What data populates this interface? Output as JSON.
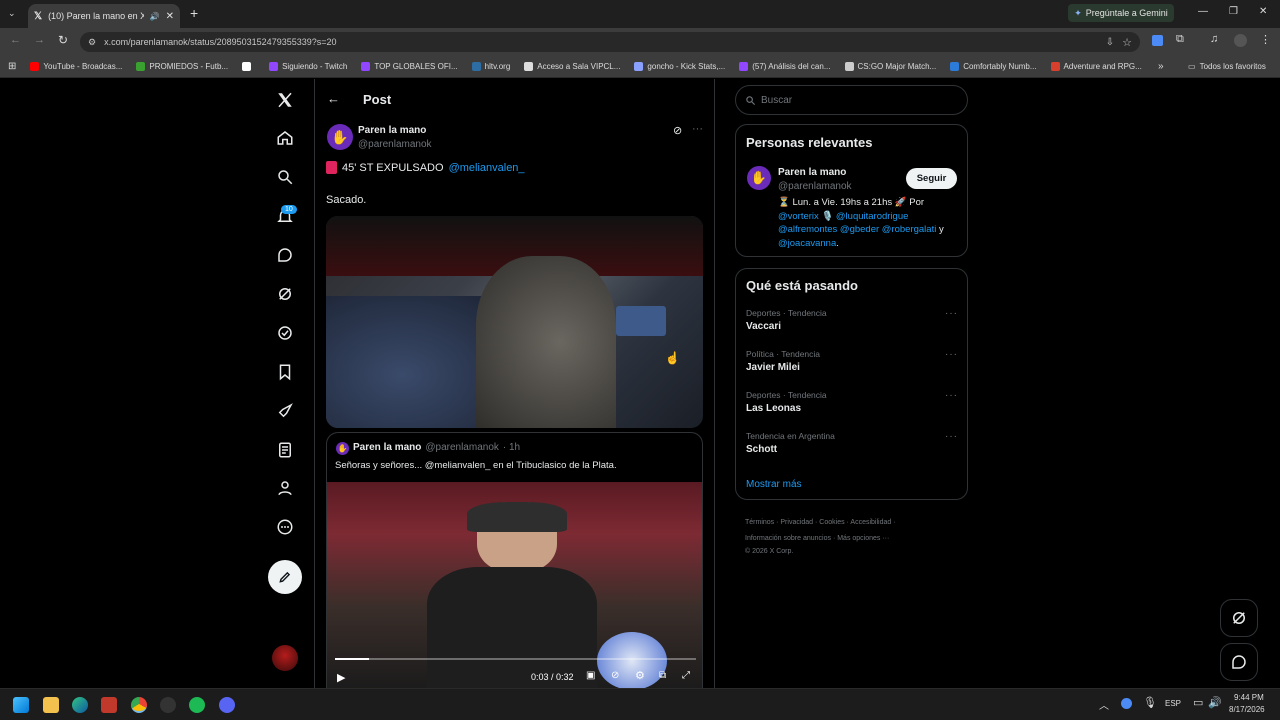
{
  "browser": {
    "tab_title": "(10) Paren la mano en X: \"",
    "url": "x.com/parenlamanok/status/2089503152479355339?s=20",
    "gemini_label": "Pregúntale a Gemini",
    "bookmarks": [
      {
        "label": "YouTube - Broadcas...",
        "color": "#ff0000"
      },
      {
        "label": "PROMIEDOS - Futb...",
        "color": "#3aa02f"
      },
      {
        "label": "",
        "color": "#ffffff"
      },
      {
        "label": "Siguiendo - Twitch",
        "color": "#9146ff"
      },
      {
        "label": "TOP GLOBALES OFI...",
        "color": "#9146ff"
      },
      {
        "label": "hltv.org",
        "color": "#2d6da3"
      },
      {
        "label": "Acceso a Sala VIPCL...",
        "color": "#dddddd"
      },
      {
        "label": "goncho - Kick Stats,...",
        "color": "#8aa0ff"
      },
      {
        "label": "(57) Análisis del can...",
        "color": "#9146ff"
      },
      {
        "label": "CS:GO Major Match...",
        "color": "#cccccc"
      },
      {
        "label": "Comfortably Numb...",
        "color": "#2d7bd8"
      },
      {
        "label": "Adventure and RPG...",
        "color": "#d8402d"
      }
    ],
    "all_bookmarks": "Todos los favoritos"
  },
  "sidebar": {
    "notification_count": "10"
  },
  "post": {
    "header_title": "Post",
    "author_name": "Paren la mano",
    "author_handle": "@parenlamanok",
    "text_prefix": "45' ST EXPULSADO",
    "text_mention": "@melianvalen_",
    "text_line2": "Sacado.",
    "quote_author": "Paren la mano",
    "quote_handle": "@parenlamanok",
    "quote_time": "· 1h",
    "quote_text": "Señoras y señores... @melianvalen_ en el Tribuclasico de la Plata.",
    "video_time": "0:03 / 0:32",
    "video_progress": 0.094
  },
  "right": {
    "search_placeholder": "Buscar",
    "relevant_title": "Personas relevantes",
    "relevant_name": "Paren la mano",
    "relevant_handle": "@parenlamanok",
    "follow_label": "Seguir",
    "bio_1": "⏳ Lun. a Vie. 19hs a 21hs 🚀 Por",
    "bio_m1": "@vorterix",
    "bio_m2": "🎙️ @luquitarodrigue",
    "bio_m3": "@alfremontes",
    "bio_m4": "@gbeder",
    "bio_m5": "@robergalati",
    "bio_y": "y",
    "bio_m6": "@joacavanna",
    "trends_title": "Qué está pasando",
    "trends": [
      {
        "category": "Deportes · Tendencia",
        "name": "Vaccari"
      },
      {
        "category": "Política · Tendencia",
        "name": "Javier Milei"
      },
      {
        "category": "Deportes · Tendencia",
        "name": "Las Leonas"
      },
      {
        "category": "Tendencia en Argentina",
        "name": "Schott"
      }
    ],
    "show_more": "Mostrar más",
    "footer_1": "Términos · Privacidad · Cookies · Accesibilidad ·",
    "footer_2": "Información sobre anuncios · Más opciones ···",
    "footer_3": "© 2026 X Corp."
  },
  "taskbar": {
    "lang": "ESP",
    "time": "9:44 PM",
    "date": "8/17/2026"
  },
  "colors": {
    "accent": "#1d9bf0",
    "follow_bg": "#eff3f4",
    "avatar_purple": "#6a2bb8"
  }
}
